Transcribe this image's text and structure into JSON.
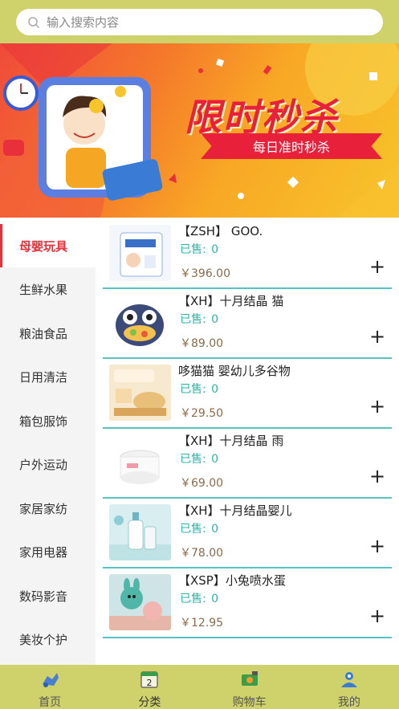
{
  "search": {
    "placeholder": "输入搜索内容",
    "icon": "search-icon"
  },
  "banner": {
    "title": "限时秒杀",
    "subtitle": "每日准时秒杀"
  },
  "categories": [
    {
      "label": "母婴玩具",
      "active": true
    },
    {
      "label": "生鲜水果"
    },
    {
      "label": "粮油食品"
    },
    {
      "label": "日用清洁"
    },
    {
      "label": "箱包服饰"
    },
    {
      "label": "户外运动"
    },
    {
      "label": "家居家纺"
    },
    {
      "label": "家用电器"
    },
    {
      "label": "数码影音"
    },
    {
      "label": "美妆个护"
    }
  ],
  "sold_label": "已售:",
  "products": [
    {
      "name": "【ZSH】 GOO.",
      "sold": "0",
      "price": "￥396.00"
    },
    {
      "name": "【XH】十月结晶 猫",
      "sold": "0",
      "price": "￥89.00"
    },
    {
      "name": "哆猫猫 婴幼儿多谷物",
      "sold": "0",
      "price": "￥29.50"
    },
    {
      "name": "【XH】十月结晶 雨",
      "sold": "0",
      "price": "￥69.00"
    },
    {
      "name": "【XH】十月结晶婴儿",
      "sold": "0",
      "price": "￥78.00"
    },
    {
      "name": "【XSP】小兔喷水蛋",
      "sold": "0",
      "price": "￥12.95"
    }
  ],
  "add_symbol": "+",
  "tabs": [
    {
      "label": "首页",
      "icon": "home-icon"
    },
    {
      "label": "分类",
      "icon": "category-icon",
      "active": true
    },
    {
      "label": "购物车",
      "icon": "cart-icon"
    },
    {
      "label": "我的",
      "icon": "profile-icon"
    }
  ]
}
